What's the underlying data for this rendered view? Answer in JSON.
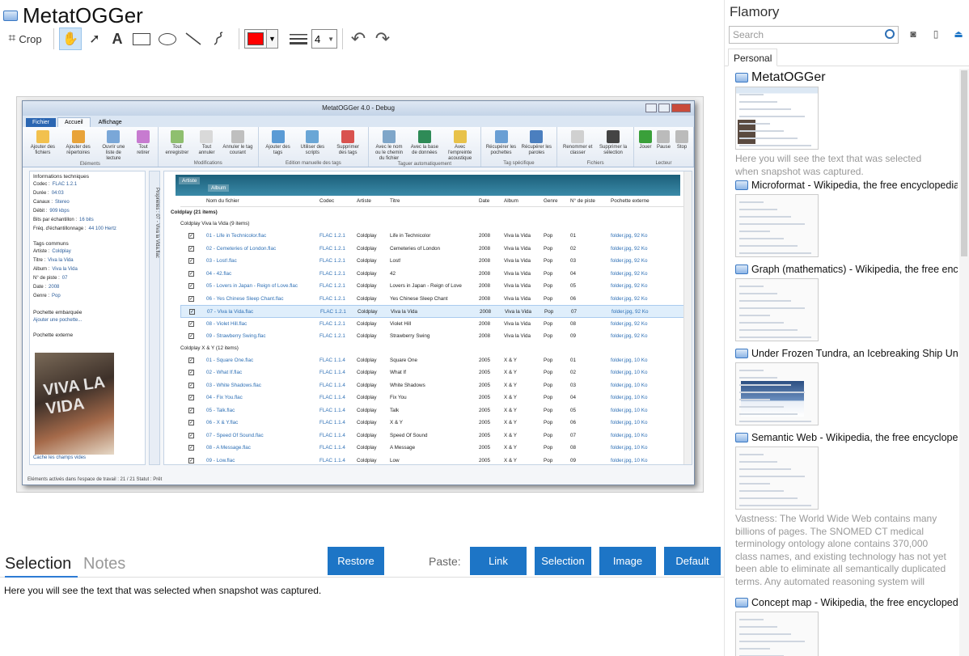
{
  "app": {
    "title": "MetatOGGer"
  },
  "toolbar": {
    "crop_label": "Crop",
    "line_width_value": "4",
    "color": "#ff0000"
  },
  "screenshot": {
    "window_title": "MetatOGGer 4.0 - Debug",
    "ribbon_tabs": [
      "Fichier",
      "Accueil",
      "Affichage"
    ],
    "ribbon_groups": [
      {
        "label": "Eléments",
        "buttons": [
          "Ajouter des fichiers",
          "Ajouter des répertoires",
          "Ouvrir une liste de lecture",
          "Tout retirer"
        ]
      },
      {
        "label": "Modifications",
        "buttons": [
          "Tout enregistrer",
          "Tout annuler",
          "Annuler le tag courant"
        ]
      },
      {
        "label": "Edition manuelle des tags",
        "buttons": [
          "Ajouter des tags",
          "Utiliser des scripts",
          "Supprimer des tags"
        ]
      },
      {
        "label": "Taguer automatiquement",
        "buttons": [
          "Avec le nom ou le chemin du fichier",
          "Avec la base de données",
          "Avec l'empreinte acoustique"
        ]
      },
      {
        "label": "Tag spécifique",
        "buttons": [
          "Récupérer les pochettes",
          "Récupérer les paroles"
        ]
      },
      {
        "label": "Fichiers",
        "buttons": [
          "Renommer et classer",
          "Supprimer la sélection"
        ]
      },
      {
        "label": "Lecteur",
        "buttons": [
          "Jouer",
          "Pause",
          "Stop"
        ]
      }
    ],
    "info_header": "Informations techniques",
    "info_rows": [
      {
        "k": "Codec :",
        "v": "FLAC 1.2.1"
      },
      {
        "k": "Durée :",
        "v": "04:03"
      },
      {
        "k": "Canaux :",
        "v": "Stereo"
      },
      {
        "k": "Débit :",
        "v": "909 kbps"
      },
      {
        "k": "Bits par échantillon :",
        "v": "16 bits"
      },
      {
        "k": "Fréq. d'échantillonnage :",
        "v": "44 100 Hertz"
      }
    ],
    "tags_header": "Tags communs",
    "tag_rows": [
      {
        "k": "Artiste :",
        "v": "Coldplay"
      },
      {
        "k": "Titre :",
        "v": "Viva la Vida"
      },
      {
        "k": "Album :",
        "v": "Viva la Vida"
      },
      {
        "k": "N° de piste :",
        "v": "07"
      },
      {
        "k": "Date :",
        "v": "2008"
      },
      {
        "k": "Genre :",
        "v": "Pop"
      }
    ],
    "embedded_cover": "Pochette embarquée",
    "add_cover": "Ajouter une pochette...",
    "external_cover": "Pochette externe",
    "album_art_text": "VIVA LA VIDA",
    "hide_empty": "Cache les champs vides",
    "vertical_tab": "Propriétés : 07 - Viva la Vida.flac",
    "band_tags": [
      "Artiste",
      "Album"
    ],
    "columns": [
      "Nom du fichier",
      "Codec",
      "Artiste",
      "Titre",
      "Date",
      "Album",
      "Genre",
      "N° de piste",
      "Pochette externe"
    ],
    "group1": "Coldplay (21 items)",
    "subgroup1": "Coldplay  Viva la Vida (9 items)",
    "rows1": [
      [
        "01 - Life in Technicolor.flac",
        "FLAC 1.2.1",
        "Coldplay",
        "Life in Technicolor",
        "2008",
        "Viva la Vida",
        "Pop",
        "01",
        "folder.jpg, 92 Ko"
      ],
      [
        "02 - Cemeteries of London.flac",
        "FLAC 1.2.1",
        "Coldplay",
        "Cemeteries of London",
        "2008",
        "Viva la Vida",
        "Pop",
        "02",
        "folder.jpg, 92 Ko"
      ],
      [
        "03 - Lost!.flac",
        "FLAC 1.2.1",
        "Coldplay",
        "Lost!",
        "2008",
        "Viva la Vida",
        "Pop",
        "03",
        "folder.jpg, 92 Ko"
      ],
      [
        "04 - 42.flac",
        "FLAC 1.2.1",
        "Coldplay",
        "42",
        "2008",
        "Viva la Vida",
        "Pop",
        "04",
        "folder.jpg, 92 Ko"
      ],
      [
        "05 - Lovers in Japan - Reign of Love.flac",
        "FLAC 1.2.1",
        "Coldplay",
        "Lovers in Japan - Reign of Love",
        "2008",
        "Viva la Vida",
        "Pop",
        "05",
        "folder.jpg, 92 Ko"
      ],
      [
        "06 - Yes  Chinese Sleep Chant.flac",
        "FLAC 1.2.1",
        "Coldplay",
        "Yes  Chinese Sleep Chant",
        "2008",
        "Viva la Vida",
        "Pop",
        "06",
        "folder.jpg, 92 Ko"
      ],
      [
        "07 - Viva la Vida.flac",
        "FLAC 1.2.1",
        "Coldplay",
        "Viva la Vida",
        "2008",
        "Viva la Vida",
        "Pop",
        "07",
        "folder.jpg, 92 Ko"
      ],
      [
        "08 - Violet Hill.flac",
        "FLAC 1.2.1",
        "Coldplay",
        "Violet Hill",
        "2008",
        "Viva la Vida",
        "Pop",
        "08",
        "folder.jpg, 92 Ko"
      ],
      [
        "09 - Strawberry Swing.flac",
        "FLAC 1.2.1",
        "Coldplay",
        "Strawberry Swing",
        "2008",
        "Viva la Vida",
        "Pop",
        "09",
        "folder.jpg, 92 Ko"
      ]
    ],
    "subgroup2": "Coldplay  X & Y (12 items)",
    "rows2": [
      [
        "01 - Square One.flac",
        "FLAC 1.1.4",
        "Coldplay",
        "Square One",
        "2005",
        "X & Y",
        "Pop",
        "01",
        "folder.jpg, 10 Ko"
      ],
      [
        "02 - What If.flac",
        "FLAC 1.1.4",
        "Coldplay",
        "What If",
        "2005",
        "X & Y",
        "Pop",
        "02",
        "folder.jpg, 10 Ko"
      ],
      [
        "03 - White Shadows.flac",
        "FLAC 1.1.4",
        "Coldplay",
        "White Shadows",
        "2005",
        "X & Y",
        "Pop",
        "03",
        "folder.jpg, 10 Ko"
      ],
      [
        "04 - Fix You.flac",
        "FLAC 1.1.4",
        "Coldplay",
        "Fix You",
        "2005",
        "X & Y",
        "Pop",
        "04",
        "folder.jpg, 10 Ko"
      ],
      [
        "05 - Talk.flac",
        "FLAC 1.1.4",
        "Coldplay",
        "Talk",
        "2005",
        "X & Y",
        "Pop",
        "05",
        "folder.jpg, 10 Ko"
      ],
      [
        "06 - X & Y.flac",
        "FLAC 1.1.4",
        "Coldplay",
        "X & Y",
        "2005",
        "X & Y",
        "Pop",
        "06",
        "folder.jpg, 10 Ko"
      ],
      [
        "07 - Speed Of Sound.flac",
        "FLAC 1.1.4",
        "Coldplay",
        "Speed Of Sound",
        "2005",
        "X & Y",
        "Pop",
        "07",
        "folder.jpg, 10 Ko"
      ],
      [
        "08 - A Message.flac",
        "FLAC 1.1.4",
        "Coldplay",
        "A Message",
        "2005",
        "X & Y",
        "Pop",
        "08",
        "folder.jpg, 10 Ko"
      ],
      [
        "09 - Low.flac",
        "FLAC 1.1.4",
        "Coldplay",
        "Low",
        "2005",
        "X & Y",
        "Pop",
        "09",
        "folder.jpg, 10 Ko"
      ]
    ],
    "status_bar": "Eléments activés dans l'espace de travail : 21 / 21     Statut : Prêt"
  },
  "bottom": {
    "tab_selection": "Selection",
    "tab_notes": "Notes",
    "restore": "Restore",
    "paste_label": "Paste:",
    "paste_buttons": [
      "Link",
      "Selection",
      "Image",
      "Default"
    ],
    "selection_text": "Here you will see the text that was selected when snapshot was captured."
  },
  "flamory": {
    "title": "Flamory",
    "search_placeholder": "Search",
    "tab_personal": "Personal",
    "items": [
      {
        "title": "MetatOGGer",
        "desc": "Here you will see the text that was selected when snapshot was captured."
      },
      {
        "title": "Microformat - Wikipedia, the free encyclopedia",
        "desc": ""
      },
      {
        "title": "Graph (mathematics) - Wikipedia, the free encyclopedia",
        "desc": ""
      },
      {
        "title": "Under Frozen Tundra, an Icebreaking Ship Uncovers",
        "desc": ""
      },
      {
        "title": "Semantic Web - Wikipedia, the free encyclopedia",
        "desc": "Vastness: The World Wide Web contains many billions of pages. The SNOMED CT medical terminology ontology alone contains 370,000 class names, and existing technology has not yet been able to eliminate all semantically duplicated terms. Any automated reasoning system will have to deal with truly huge inputs."
      },
      {
        "title": "Concept map - Wikipedia, the free encyclopedia",
        "desc": ""
      }
    ]
  },
  "colors": {
    "accent": "#1d75c6",
    "tab_underline": "#2d7bd4"
  }
}
